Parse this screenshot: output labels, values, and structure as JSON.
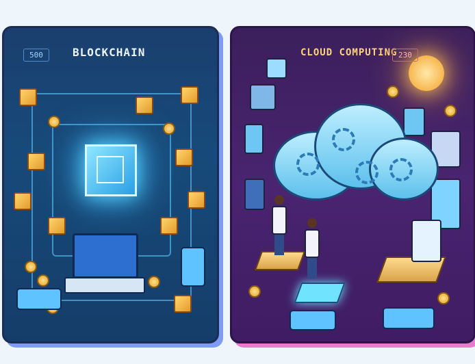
{
  "left_card": {
    "title": "BLOCKCHAIN",
    "stat": "500",
    "colors": {
      "accent": "#5ec8ff",
      "block": "#ffd56b",
      "core": "#2a9fe6"
    }
  },
  "right_card": {
    "title": "CLOUD COMPUTING",
    "stat": "230",
    "colors": {
      "accent": "#ffd37a",
      "cloud": "#5dc0ec",
      "sun": "#f4a12a"
    }
  },
  "icons": [
    "cube-icon",
    "coin-icon",
    "laptop-icon",
    "phone-icon",
    "cloud-icon",
    "gear-icon",
    "sun-icon",
    "person-icon"
  ]
}
